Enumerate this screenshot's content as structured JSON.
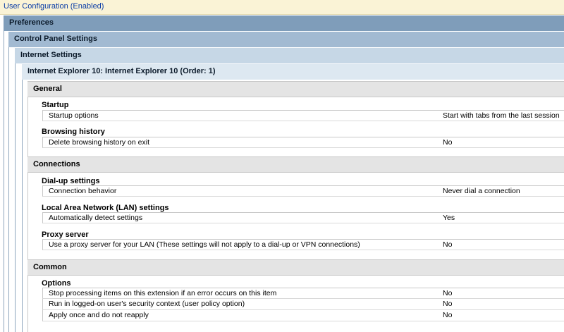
{
  "header": {
    "title": "User Configuration (Enabled)"
  },
  "tree": {
    "level1": "Preferences",
    "level2": "Control Panel Settings",
    "level3": "Internet Settings",
    "level4": "Internet Explorer 10: Internet Explorer 10 (Order: 1)"
  },
  "sections": [
    {
      "title": "General",
      "groups": [
        {
          "title": "Startup",
          "rows": [
            {
              "label": "Startup options",
              "value": "Start with tabs from the last session"
            }
          ]
        },
        {
          "title": "Browsing history",
          "rows": [
            {
              "label": "Delete browsing history on exit",
              "value": "No"
            }
          ]
        }
      ]
    },
    {
      "title": "Connections",
      "groups": [
        {
          "title": "Dial-up settings",
          "rows": [
            {
              "label": "Connection behavior",
              "value": "Never dial a connection"
            }
          ]
        },
        {
          "title": "Local Area Network (LAN) settings",
          "rows": [
            {
              "label": "Automatically detect settings",
              "value": "Yes"
            }
          ]
        },
        {
          "title": "Proxy server",
          "rows": [
            {
              "label": "Use a proxy server for your LAN (These settings will not apply to a dial-up or VPN connections)",
              "value": "No"
            }
          ]
        }
      ]
    },
    {
      "title": "Common",
      "groups": [
        {
          "title": "Options",
          "rows": [
            {
              "label": "Stop processing items on this extension if an error occurs on this item",
              "value": "No"
            },
            {
              "label": "Run in logged-on user's security context (user policy option)",
              "value": "No"
            },
            {
              "label": "Apply once and do not reapply",
              "value": "No"
            }
          ]
        }
      ]
    }
  ]
}
